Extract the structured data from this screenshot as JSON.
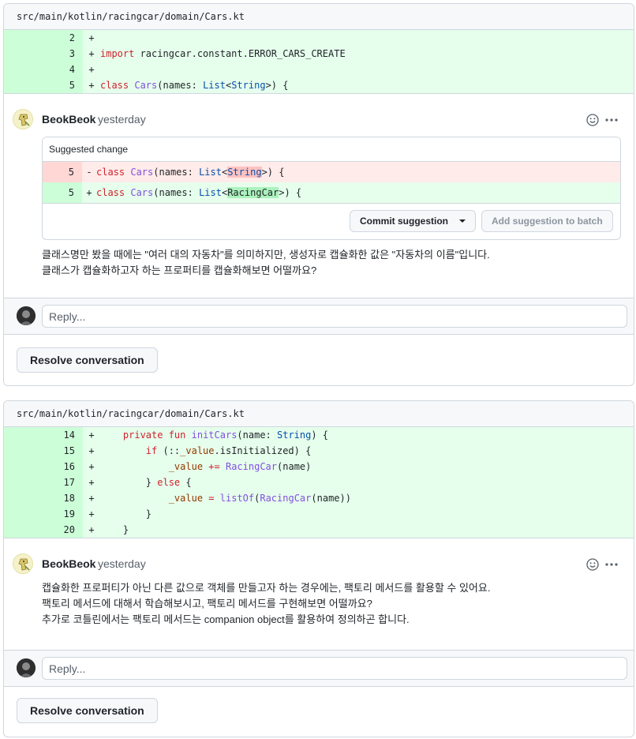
{
  "thread1": {
    "file_path": "src/main/kotlin/racingcar/domain/Cars.kt",
    "diff_lines": [
      {
        "num": "2",
        "mark": "+",
        "code": ""
      },
      {
        "num": "3",
        "mark": "+",
        "code": "import racingcar.constant.ERROR_CARS_CREATE"
      },
      {
        "num": "4",
        "mark": "+",
        "code": ""
      },
      {
        "num": "5",
        "mark": "+",
        "code": "class Cars(names: List<String>) {"
      }
    ],
    "author": "BeokBeok",
    "time": "yesterday",
    "suggestion": {
      "header": "Suggested change",
      "del": {
        "num": "5",
        "mark": "-",
        "before": "class Cars(names: List<",
        "highlight": "String",
        "after": ">) {"
      },
      "add": {
        "num": "5",
        "mark": "+",
        "before": "class Cars(names: List<",
        "highlight": "RacingCar",
        "after": ">) {"
      },
      "commit_label": "Commit suggestion",
      "batch_label": "Add suggestion to batch"
    },
    "body": [
      "클래스명만 봤을 때에는 \"여러 대의 자동차\"를 의미하지만, 생성자로 캡슐화한 값은 \"자동차의 이름\"입니다.",
      "클래스가 캡슐화하고자 하는 프로퍼티를 캡슐화해보면 어떨까요?"
    ],
    "reply_placeholder": "Reply...",
    "resolve_label": "Resolve conversation"
  },
  "thread2": {
    "file_path": "src/main/kotlin/racingcar/domain/Cars.kt",
    "diff_lines": [
      {
        "num": "14",
        "mark": "+",
        "code": "    private fun initCars(name: String) {"
      },
      {
        "num": "15",
        "mark": "+",
        "code": "        if (::_value.isInitialized) {"
      },
      {
        "num": "16",
        "mark": "+",
        "code": "            _value += RacingCar(name)"
      },
      {
        "num": "17",
        "mark": "+",
        "code": "        } else {"
      },
      {
        "num": "18",
        "mark": "+",
        "code": "            _value = listOf(RacingCar(name))"
      },
      {
        "num": "19",
        "mark": "+",
        "code": "        }"
      },
      {
        "num": "20",
        "mark": "+",
        "code": "    }"
      }
    ],
    "author": "BeokBeok",
    "time": "yesterday",
    "body": [
      "캡슐화한 프로퍼티가 아닌 다른 값으로 객체를 만들고자 하는 경우에는, 팩토리 메서드를 활용할 수 있어요.",
      "팩토리 메서드에 대해서 학습해보시고, 팩토리 메서드를 구현해보면 어떨까요?",
      "추가로 코틀린에서는 팩토리 메서드는 companion object를 활용하여 정의하곤 합니다."
    ],
    "reply_placeholder": "Reply...",
    "resolve_label": "Resolve conversation"
  },
  "icons": {
    "emoji": "smiley-icon",
    "more": "kebab-horizontal-icon"
  },
  "colors": {
    "add_bg": "#e6ffec",
    "add_num_bg": "#ccffd8",
    "del_bg": "#ffebe9",
    "border": "#d0d7de"
  }
}
